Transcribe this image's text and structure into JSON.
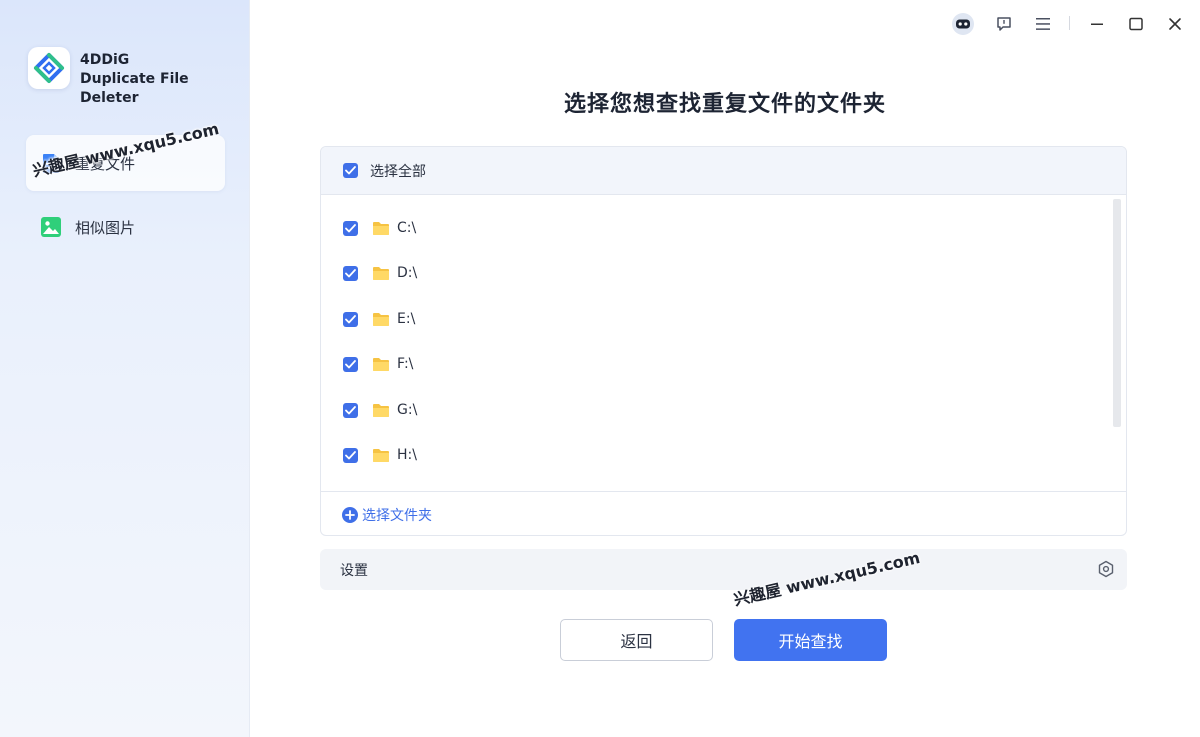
{
  "app": {
    "name_line1": "4DDiG",
    "name_line2": "Duplicate File Deleter"
  },
  "sidebar": {
    "items": [
      {
        "label": "重复文件",
        "icon": "file-icon",
        "active": true
      },
      {
        "label": "相似图片",
        "icon": "image-icon",
        "active": false
      }
    ]
  },
  "titlebar": {
    "icons": [
      "assistant-bot-icon",
      "feedback-icon",
      "menu-icon",
      "minimize-icon",
      "maximize-icon",
      "close-icon"
    ]
  },
  "main": {
    "title": "选择您想查找重复文件的文件夹",
    "select_all_label": "选择全部",
    "select_all_checked": true,
    "drives": [
      {
        "label": "C:\\",
        "checked": true
      },
      {
        "label": "D:\\",
        "checked": true
      },
      {
        "label": "E:\\",
        "checked": true
      },
      {
        "label": "F:\\",
        "checked": true
      },
      {
        "label": "G:\\",
        "checked": true
      },
      {
        "label": "H:\\",
        "checked": true
      }
    ],
    "add_folder_label": "选择文件夹",
    "settings_label": "设置",
    "back_button": "返回",
    "start_button": "开始查找"
  },
  "watermark": {
    "text": "兴趣屋 www.xqu5.com"
  },
  "colors": {
    "accent": "#4173f0",
    "checkbox": "#3f6fe8",
    "folder": "#f6c343",
    "nav_file_icon": "#3b82f6",
    "nav_image_icon": "#2fcf7a"
  }
}
